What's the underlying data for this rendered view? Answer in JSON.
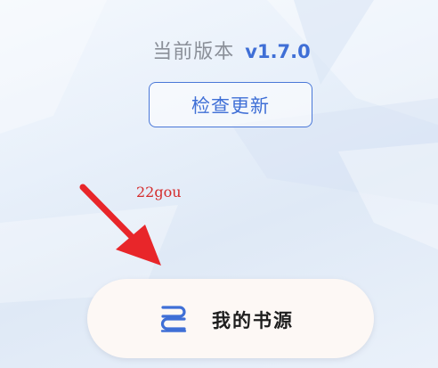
{
  "version": {
    "label": "当前版本",
    "value": "v1.7.0"
  },
  "update_button": {
    "label": "检查更新"
  },
  "watermark": {
    "text": "22gou"
  },
  "book_source_button": {
    "label": "我的书源",
    "icon": "book-source-icon"
  },
  "colors": {
    "accent": "#3f6fd6",
    "arrow": "#e8262a",
    "watermark": "#d42b2b"
  }
}
